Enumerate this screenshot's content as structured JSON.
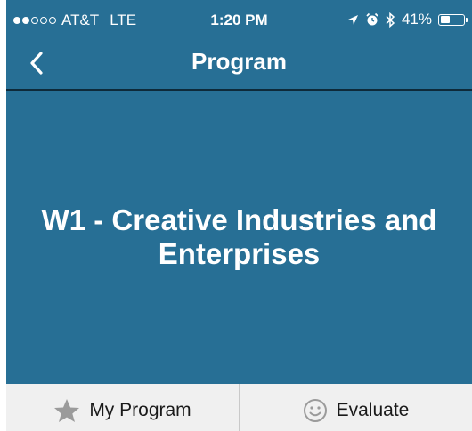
{
  "status_bar": {
    "carrier": "AT&T",
    "network": "LTE",
    "time": "1:20 PM",
    "battery": "41%",
    "battery_level": 0.41,
    "signal_bars": 2,
    "icons": [
      "location-arrow-icon",
      "alarm-icon",
      "bluetooth-icon",
      "battery-icon"
    ]
  },
  "nav": {
    "title": "Program",
    "back_icon": "chevron-left-icon"
  },
  "main": {
    "title": "W1 - Creative Industries and Enterprises"
  },
  "tabs": [
    {
      "label": "My Program",
      "icon": "star-icon"
    },
    {
      "label": "Evaluate",
      "icon": "smiley-icon"
    }
  ],
  "colors": {
    "primary": "#276f95",
    "tab_bar_bg": "#f0f0f0",
    "icon_gray": "#9b9b9b"
  }
}
